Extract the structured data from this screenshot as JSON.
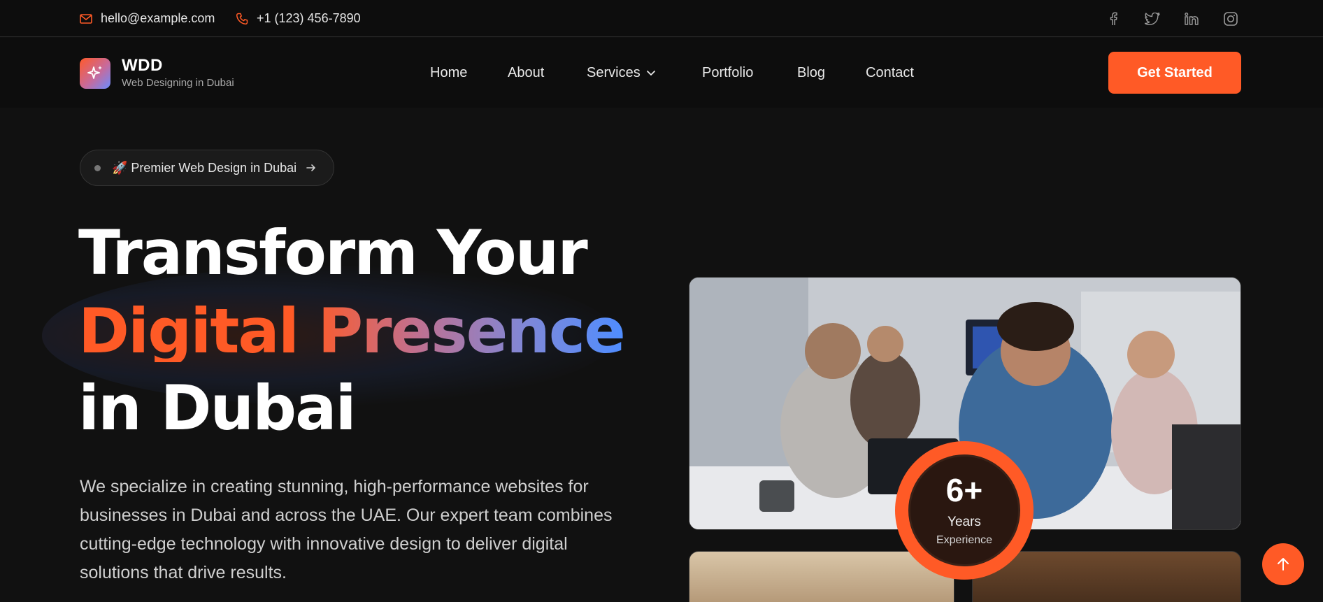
{
  "topbar": {
    "email": "hello@example.com",
    "phone": "+1 (123) 456-7890",
    "socials": [
      "facebook-icon",
      "twitter-icon",
      "linkedin-icon",
      "instagram-icon"
    ]
  },
  "brand": {
    "name": "WDD",
    "tagline": "Web Designing in Dubai"
  },
  "nav": {
    "items": [
      {
        "label": "Home"
      },
      {
        "label": "About"
      },
      {
        "label": "Services"
      },
      {
        "label": "Portfolio"
      },
      {
        "label": "Blog"
      },
      {
        "label": "Contact"
      }
    ],
    "cta": "Get Started"
  },
  "hero": {
    "pill": "🚀 Premier Web Design in Dubai",
    "headline_line1": "Transform Your",
    "headline_line2": "Digital Presence",
    "headline_line3": "in Dubai",
    "description": "We specialize in creating stunning, high-performance websites for businesses in Dubai and across the UAE. Our expert team combines cutting-edge technology with innovative design to deliver digital solutions that drive results."
  },
  "badge": {
    "value": "6+",
    "label": "Years",
    "sublabel": "Experience"
  },
  "colors": {
    "accent": "#ff5a26",
    "background": "#111111",
    "gradient_end": "#4f8dff"
  }
}
